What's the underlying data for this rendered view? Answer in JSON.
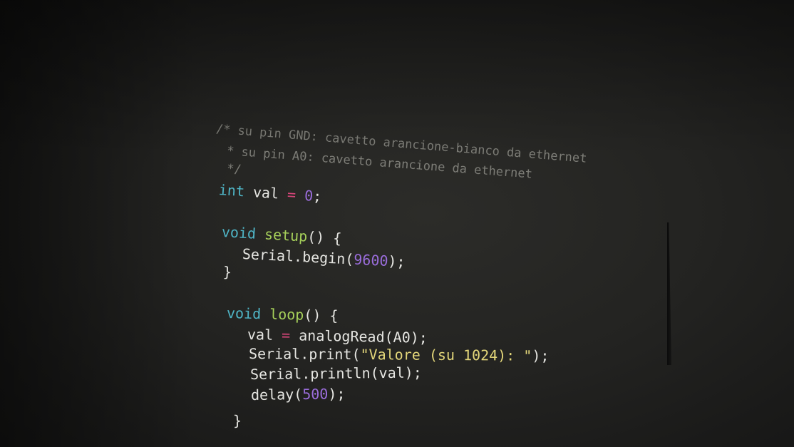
{
  "code": {
    "comment_line1": "/* su pin GND: cavetto arancione-bianco da ethernet",
    "comment_line2": " * su pin A0: cavetto arancione da ethernet",
    "comment_line3": " */",
    "decl": {
      "type": "int",
      "name": " val ",
      "op": "=",
      "space": " ",
      "value": "0",
      "end": ";"
    },
    "setup": {
      "kw": "void",
      "name": "setup",
      "tail": "() {",
      "body_prefix": "Serial.begin(",
      "body_num": "9600",
      "body_suffix": ");",
      "close": "}"
    },
    "loop": {
      "kw": "void",
      "name": "loop",
      "tail": "() {",
      "l1_name": "val ",
      "l1_op": "=",
      "l1_rest": " analogRead(A0);",
      "l2_prefix": "Serial.print(",
      "l2_str": "\"Valore (su 1024): \"",
      "l2_suffix": ");",
      "l3": "Serial.println(val);",
      "l4_prefix": "delay(",
      "l4_num": "500",
      "l4_suffix": ");",
      "close": "}"
    }
  }
}
